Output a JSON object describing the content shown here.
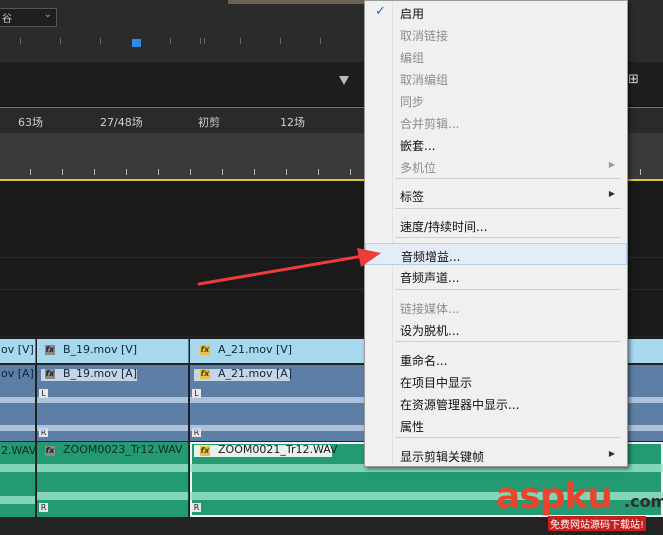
{
  "top": {
    "dropdown_text": "谷"
  },
  "markers": [
    "63场",
    "27/48场",
    "初剪",
    "12场"
  ],
  "tracks": {
    "v1": [
      {
        "label": "ov [V]",
        "fx": false
      },
      {
        "label": "B_19.mov [V]",
        "fx": true,
        "fx_color": "gray"
      },
      {
        "label": "A_21.mov [V]",
        "fx": true,
        "fx_color": "gold"
      }
    ],
    "a1": [
      {
        "label": "ov [A]",
        "fx": false
      },
      {
        "label": "B_19.mov [A]",
        "fx": true,
        "fx_color": "gray"
      },
      {
        "label": "A_21.mov [A]",
        "fx": true,
        "fx_color": "gold"
      }
    ],
    "a2": [
      {
        "label": "2.WAV",
        "fx": false
      },
      {
        "label": "ZOOM0023_Tr12.WAV",
        "fx": true,
        "fx_color": "gray"
      },
      {
        "label": "ZOOM0021_Tr12.WAV",
        "fx": true,
        "fx_color": "gold"
      }
    ],
    "channel_left": "L",
    "channel_right": "R",
    "fx_text": "fx"
  },
  "context_menu": {
    "items": [
      {
        "label": "启用",
        "checked": true,
        "disabled": false
      },
      {
        "label": "取消链接",
        "disabled": true
      },
      {
        "label": "编组",
        "disabled": true
      },
      {
        "label": "取消编组",
        "disabled": true
      },
      {
        "label": "同步",
        "disabled": true
      },
      {
        "label": "合并剪辑...",
        "disabled": true
      },
      {
        "label": "嵌套...",
        "disabled": false
      },
      {
        "label": "多机位",
        "disabled": true,
        "submenu": true
      },
      {
        "label": "标签",
        "disabled": false,
        "submenu": true
      },
      {
        "label": "速度/持续时间...",
        "disabled": false
      },
      {
        "label": "音频增益...",
        "disabled": false,
        "highlighted": true
      },
      {
        "label": "音频声道...",
        "disabled": false
      },
      {
        "label": "链接媒体...",
        "disabled": true
      },
      {
        "label": "设为脱机...",
        "disabled": false
      },
      {
        "label": "重命名...",
        "disabled": false
      },
      {
        "label": "在项目中显示",
        "disabled": false
      },
      {
        "label": "在资源管理器中显示...",
        "disabled": false
      },
      {
        "label": "属性",
        "disabled": false
      },
      {
        "label": "显示剪辑关键帧",
        "disabled": false,
        "submenu": true
      }
    ],
    "check_glyph": "✓",
    "submenu_glyph": "▶"
  },
  "watermark": {
    "main": "aspku",
    "suffix": ".com",
    "sub": "免费网站源码下载站!"
  },
  "colors": {
    "video_clip": "#a7d8ee",
    "audio_clip": "#5e7fa5",
    "audio_green": "#249a72",
    "playhead": "#2d8ceb",
    "work_area": "#d9c83a",
    "arrow": "#ee3b3b",
    "watermark": "#e8442e"
  }
}
